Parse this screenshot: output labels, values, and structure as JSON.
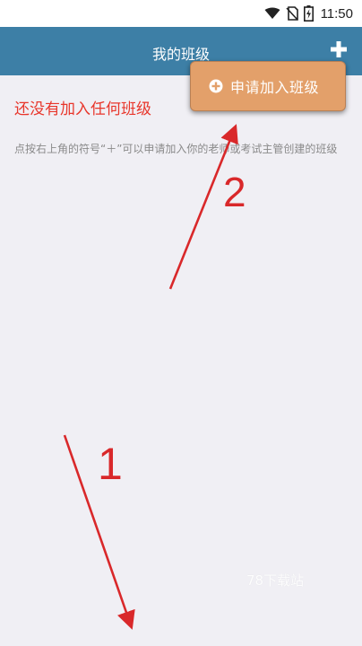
{
  "status_bar": {
    "time": "11:50",
    "icons": [
      "wifi-icon",
      "no-sim-icon",
      "battery-charging-icon"
    ]
  },
  "app_bar": {
    "title": "我的班级",
    "add_icon": "plus-icon"
  },
  "empty_state": {
    "title": "还没有加入任何班级",
    "hint": "点按右上角的符号“＋”可以申请加入你的老师或考试主管创建的班级"
  },
  "popup_menu": {
    "item_icon": "plus-circle-icon",
    "item_label": "申请加入班级"
  },
  "annotations": {
    "step_1": "1",
    "step_2": "2",
    "color": "#d9282a"
  },
  "watermark": "78下载站",
  "colors": {
    "app_bar": "#3d7fa6",
    "popup": "#e3a06a",
    "empty_title": "#e8362b",
    "background": "#f0eff4"
  }
}
